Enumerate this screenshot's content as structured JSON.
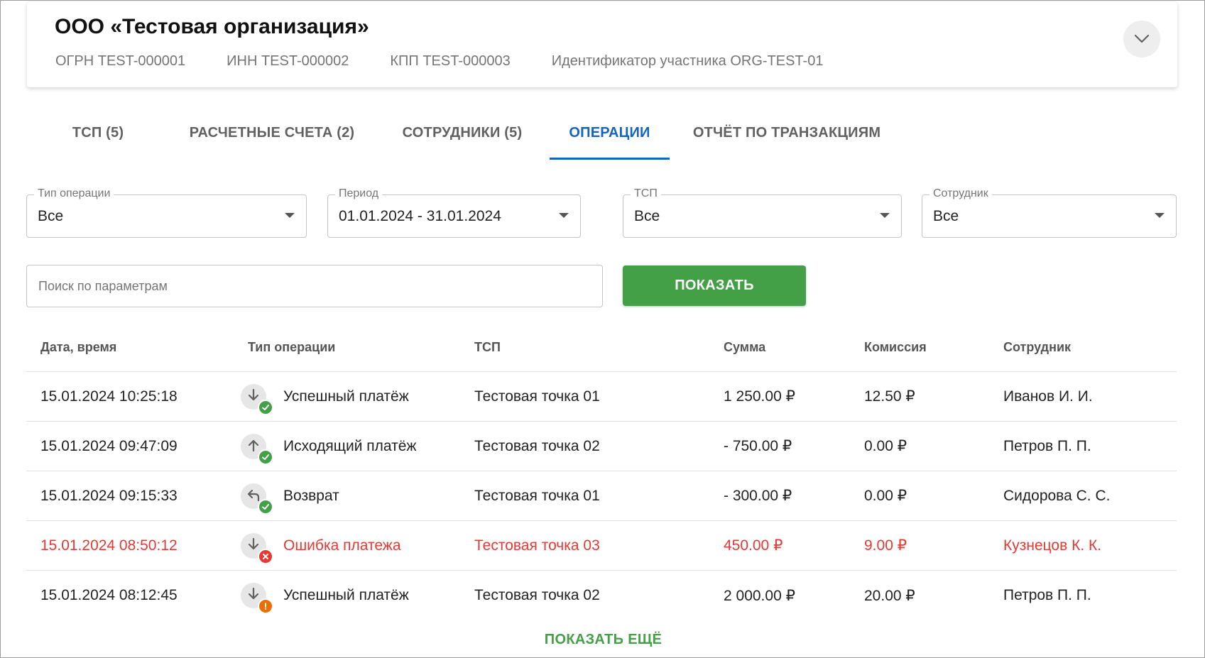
{
  "org": {
    "title": "ООО «Тестовая организация»",
    "ogrn": "ОГРН TEST-000001",
    "inn": "ИНН TEST-000002",
    "kpp": "КПП TEST-000003",
    "participant_id": "Идентификатор участника ORG-TEST-01"
  },
  "tabs": [
    {
      "label": "ТСП (5)"
    },
    {
      "label": "РАСЧЕТНЫЕ СЧЕТА (2)"
    },
    {
      "label": "СОТРУДНИКИ (5)"
    },
    {
      "label": "ОПЕРАЦИИ",
      "active": true
    },
    {
      "label": "ОТЧЁТ ПО ТРАНЗАКЦИЯМ"
    }
  ],
  "filters": {
    "operation_type": {
      "label": "Тип операции",
      "value": "Все"
    },
    "period": {
      "label": "Период",
      "value": "01.01.2024 - 31.01.2024"
    },
    "tsp": {
      "label": "ТСП",
      "value": "Все"
    },
    "employee": {
      "label": "Сотрудник",
      "value": "Все"
    }
  },
  "search": {
    "placeholder": "Поиск по параметрам",
    "value": ""
  },
  "show_button": "ПОКАЗАТЬ",
  "table": {
    "headers": {
      "datetime": "Дата, время",
      "type": "Тип операции",
      "tsp": "ТСП",
      "amount": "Сумма",
      "commission": "Комиссия",
      "employee": "Сотрудник"
    },
    "rows": [
      {
        "datetime": "15.01.2024 10:25:18",
        "type": "Успешный платёж",
        "direction": "incoming",
        "status": "success",
        "tsp": "Тестовая точка 01",
        "amount": "1 250.00 ₽",
        "commission": "12.50 ₽",
        "employee": "Иванов И. И."
      },
      {
        "datetime": "15.01.2024 09:47:09",
        "type": "Исходящий платёж",
        "direction": "outgoing",
        "status": "success",
        "tsp": "Тестовая точка 02",
        "amount": "- 750.00 ₽",
        "commission": "0.00 ₽",
        "employee": "Петров П. П."
      },
      {
        "datetime": "15.01.2024 09:15:33",
        "type": "Возврат",
        "direction": "refund",
        "status": "success",
        "tsp": "Тестовая точка 01",
        "amount": "- 300.00 ₽",
        "commission": "0.00 ₽",
        "employee": "Сидорова С. С."
      },
      {
        "datetime": "15.01.2024 08:50:12",
        "type": "Ошибка платежа",
        "direction": "incoming",
        "status": "error",
        "tsp": "Тестовая точка 03",
        "amount": "450.00 ₽",
        "commission": "9.00 ₽",
        "employee": "Кузнецов К. К."
      },
      {
        "datetime": "15.01.2024 08:12:45",
        "type": "Успешный платёж",
        "direction": "incoming",
        "status": "warning",
        "tsp": "Тестовая точка 02",
        "amount": "2 000.00 ₽",
        "commission": "20.00 ₽",
        "employee": "Петров П. П."
      }
    ]
  },
  "show_more": "ПОКАЗАТЬ ЕЩЁ",
  "colors": {
    "accent_blue": "#1565c0",
    "success_green": "#43a047",
    "error_red": "#e53935",
    "warning_orange": "#ef6c00"
  }
}
